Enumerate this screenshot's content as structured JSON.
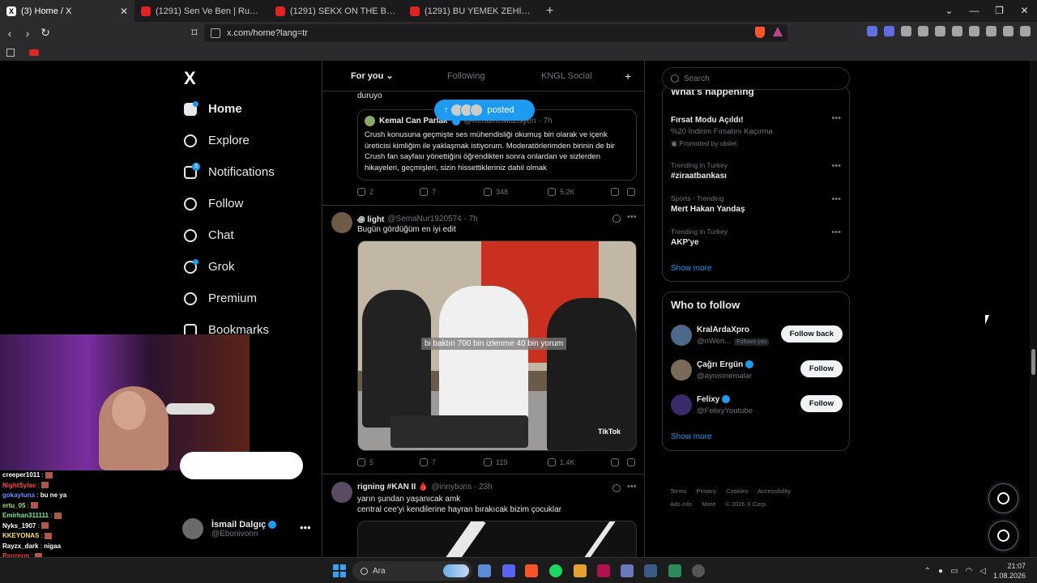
{
  "browser": {
    "tabs": [
      {
        "title": "(3) Home / X",
        "icon": "x-icon",
        "active": true
      },
      {
        "title": "(1291) Sen Ve Ben | Ruddy - YouTube",
        "icon": "youtube-icon",
        "active": false
      },
      {
        "title": "(1291) SEKX ON THE BİÇ | Madara Ol",
        "icon": "youtube-icon",
        "active": false
      },
      {
        "title": "(1291) BU YEMEK ZEHİRLERİ EFE UYG",
        "icon": "youtube-icon",
        "active": false
      }
    ],
    "new_tab": "+",
    "url": "x.com/home?lang=tr",
    "accent": "#fb542b"
  },
  "nav": {
    "logo": "X",
    "items": [
      "Home",
      "Explore",
      "Notifications",
      "Follow",
      "Chat",
      "Grok",
      "Premium",
      "Bookmarks"
    ],
    "notif_badge": "3",
    "account": {
      "name": "İsmail Dalgıç",
      "handle": "@Ebonivonn"
    }
  },
  "stream_chat": [
    {
      "user": "creeper1011",
      "msg": "",
      "color": "#ffffff"
    },
    {
      "user": "NightSylas",
      "msg": "",
      "color": "#ff4b4b"
    },
    {
      "user": "gokaytuna",
      "msg": "bu ne ya",
      "color": "#6a8cff"
    },
    {
      "user": "ertu_05",
      "msg": "",
      "color": "#9be07a"
    },
    {
      "user": "Emirhan311111",
      "msg": "",
      "color": "#6cf0a0"
    },
    {
      "user": "Nyks_1907",
      "msg": "",
      "color": "#ffffff"
    },
    {
      "user": "KKEYONAS",
      "msg": "",
      "color": "#ffe066"
    },
    {
      "user": "Rayzx_dark",
      "msg": "nigaa",
      "color": "#ffffff"
    },
    {
      "user": "Panzerm",
      "msg": "",
      "color": "#ff3b3b"
    }
  ],
  "feed": {
    "tabs": [
      "For you",
      "Following",
      "KNGL Social"
    ],
    "add": "+",
    "posted_label": "posted",
    "post1": {
      "text_tail": "duruyo",
      "quote": {
        "name": "Kemal Can Parlak",
        "handle": "@KendineMuzisyen · 7h",
        "body": "Crush konusuna geçmişte ses mühendisliği okumuş biri olarak ve içerik üreticisi kimliğim ile yaklaşmak istiyorum. Moderatörlerimden birinin de bir Crush fan sayfası yönettiğini öğrendikten sonra onlardan ve sizlerden hikayeleri, geçmişleri, sizin hissettikleriniz dahil olmak"
      },
      "replies": "2",
      "reposts": "7",
      "likes": "348",
      "views": "5.2K"
    },
    "post2": {
      "name": "꩜ light",
      "handle": "@SemaNur1920574 · 7h",
      "text": "Bugün gördüğüm en iyi edit",
      "media_caption": "bi baktın 700 bin izlenme 40 bin yorum",
      "watermark": "TikTok",
      "replies": "5",
      "reposts": "7",
      "likes": "119",
      "views": "1.4K"
    },
    "post3": {
      "name": "rigning #KAN II 🩸",
      "handle": "@innytions · 23h",
      "text1": "yarın şundan yaşanıcak amk",
      "text2": "central cee'yi kendilerine hayran bırakıcak bizim çocuklar"
    }
  },
  "sidebar": {
    "search_placeholder": "Search",
    "trending_header": "What's happening",
    "trends": [
      {
        "meta": "",
        "title": "Fırsat Modu Açıldı!",
        "sub": "%20 İndirim Fırsatını Kaçırma",
        "extra": "Promoted by obilet"
      },
      {
        "meta": "Trending in Turkey",
        "title": "#ziraatbankası",
        "sub": "",
        "extra": ""
      },
      {
        "meta": "Sports · Trending",
        "title": "Mert Hakan Yandaş",
        "sub": "",
        "extra": ""
      },
      {
        "meta": "Trending in Turkey",
        "title": "AKP'ye",
        "sub": "",
        "extra": ""
      }
    ],
    "show_more": "Show more",
    "who_header": "Who to follow",
    "who": [
      {
        "name": "KralArdaXpro",
        "handle": "@nWen...",
        "tag": "Follows you",
        "button": "Follow back"
      },
      {
        "name": "Çağrı Ergün",
        "handle": "@aynisinemalar",
        "tag": "",
        "button": "Follow"
      },
      {
        "name": "Felixy",
        "handle": "@FelixyYoutube",
        "tag": "",
        "button": "Follow"
      }
    ],
    "footer": [
      "Terms",
      "Privacy",
      "Cookies",
      "Accessibility",
      "Ads info",
      "More",
      "© 2026 X Corp."
    ]
  },
  "taskbar": {
    "search": "Ara",
    "time": "21:07",
    "date": "1.08.2026"
  }
}
